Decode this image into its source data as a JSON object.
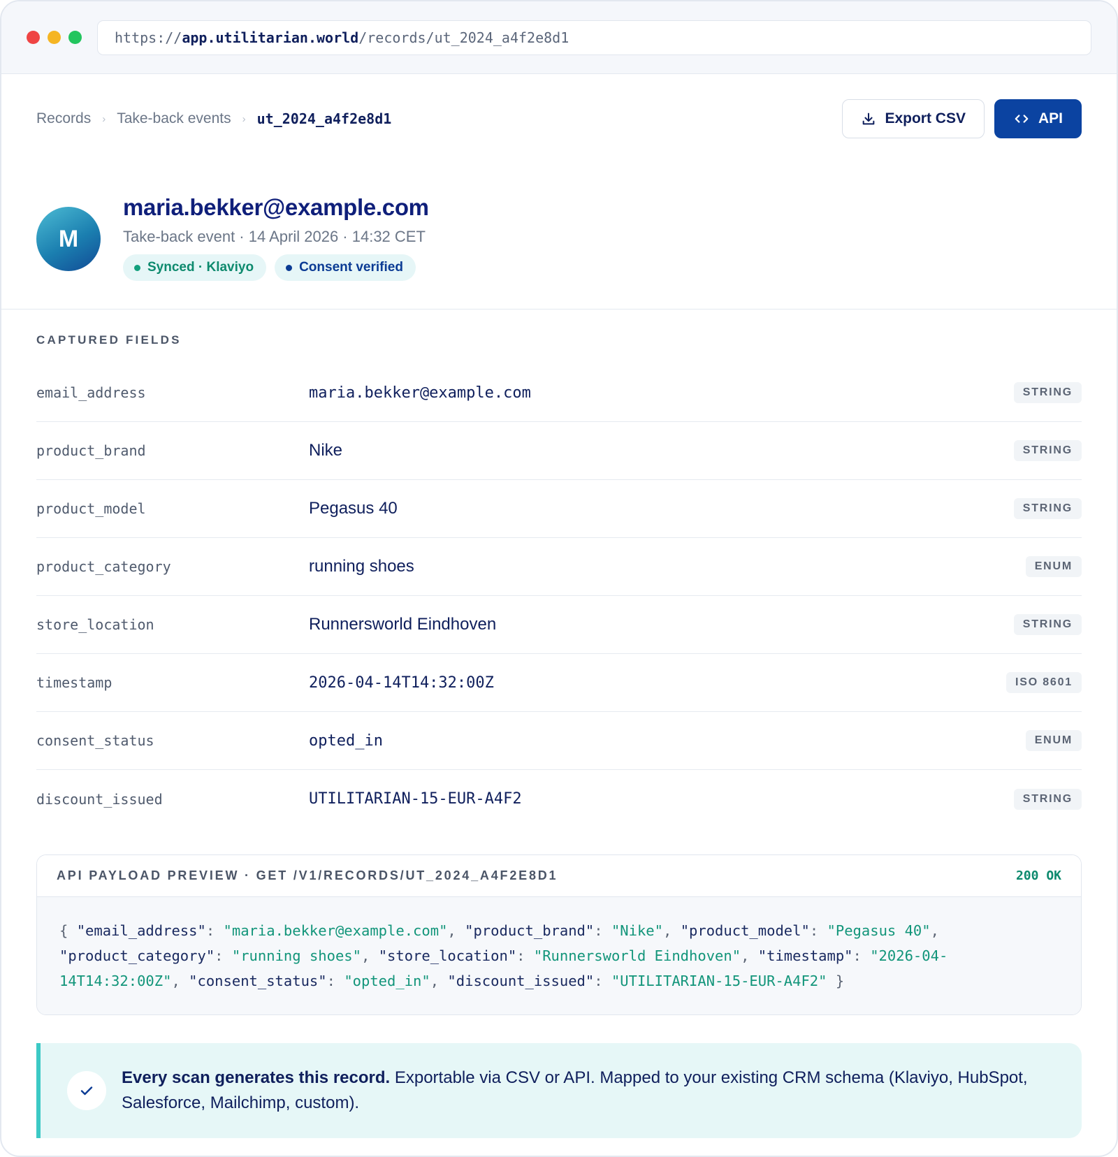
{
  "browser": {
    "url_scheme": "https://",
    "url_host": "app.utilitarian.world",
    "url_path": "/records/ut_2024_a4f2e8d1"
  },
  "breadcrumb": {
    "items": [
      "Records",
      "Take-back events"
    ],
    "current": "ut_2024_a4f2e8d1"
  },
  "actions": {
    "export_label": "Export CSV",
    "api_label": "API"
  },
  "profile": {
    "avatar_initial": "M",
    "email": "maria.bekker@example.com",
    "subtitle": "Take-back event · 14 April 2026 · 14:32 CET",
    "badges": [
      "Synced · Klaviyo",
      "Consent verified"
    ]
  },
  "fields": {
    "section_label": "CAPTURED FIELDS",
    "rows": [
      {
        "key": "email_address",
        "value": "maria.bekker@example.com",
        "type": "STRING"
      },
      {
        "key": "product_brand",
        "value": "Nike",
        "type": "STRING"
      },
      {
        "key": "product_model",
        "value": "Pegasus 40",
        "type": "STRING"
      },
      {
        "key": "product_category",
        "value": "running shoes",
        "type": "ENUM"
      },
      {
        "key": "store_location",
        "value": "Runnersworld Eindhoven",
        "type": "STRING"
      },
      {
        "key": "timestamp",
        "value": "2026-04-14T14:32:00Z",
        "type": "ISO 8601"
      },
      {
        "key": "consent_status",
        "value": "opted_in",
        "type": "ENUM"
      },
      {
        "key": "discount_issued",
        "value": "UTILITARIAN-15-EUR-A4F2",
        "type": "STRING"
      }
    ]
  },
  "payload": {
    "title": "API PAYLOAD PREVIEW · GET /V1/RECORDS/UT_2024_A4F2E8D1",
    "status": "200 OK",
    "line1": [
      {
        "t": "{ ",
        "c": "p"
      },
      {
        "t": "\"email_address\"",
        "c": "k"
      },
      {
        "t": ": ",
        "c": "p"
      },
      {
        "t": "\"maria.bekker@example.com\"",
        "c": "v"
      },
      {
        "t": ", ",
        "c": "p"
      },
      {
        "t": "\"product_brand\"",
        "c": "k"
      },
      {
        "t": ": ",
        "c": "p"
      },
      {
        "t": "\"Nike\"",
        "c": "v"
      },
      {
        "t": ", ",
        "c": "p"
      },
      {
        "t": "\"product_model\"",
        "c": "k"
      },
      {
        "t": ": ",
        "c": "p"
      },
      {
        "t": "\"Pegasus 40\"",
        "c": "v"
      },
      {
        "t": ",",
        "c": "p"
      }
    ],
    "line2": [
      {
        "t": "\"product_category\"",
        "c": "k"
      },
      {
        "t": ": ",
        "c": "p"
      },
      {
        "t": "\"running shoes\"",
        "c": "v"
      },
      {
        "t": ", ",
        "c": "p"
      },
      {
        "t": "\"store_location\"",
        "c": "k"
      },
      {
        "t": ": ",
        "c": "p"
      },
      {
        "t": "\"Runnersworld Eindhoven\"",
        "c": "v"
      },
      {
        "t": ", ",
        "c": "p"
      },
      {
        "t": "\"timestamp\"",
        "c": "k"
      },
      {
        "t": ": ",
        "c": "p"
      },
      {
        "t": "\"2026-04-",
        "c": "v"
      }
    ],
    "line3": [
      {
        "t": "14T14:32:00Z\"",
        "c": "v"
      },
      {
        "t": ", ",
        "c": "p"
      },
      {
        "t": "\"consent_status\"",
        "c": "k"
      },
      {
        "t": ": ",
        "c": "p"
      },
      {
        "t": "\"opted_in\"",
        "c": "v"
      },
      {
        "t": ", ",
        "c": "p"
      },
      {
        "t": "\"discount_issued\"",
        "c": "k"
      },
      {
        "t": ": ",
        "c": "p"
      },
      {
        "t": "\"UTILITARIAN-15-EUR-A4F2\"",
        "c": "v"
      },
      {
        "t": " }",
        "c": "p"
      }
    ]
  },
  "callout": {
    "bold": "Every scan generates this record.",
    "text": " Exportable via CSV or API. Mapped to your existing CRM schema (Klaviyo, HubSpot, Salesforce, Mailchimp, custom)."
  },
  "colors": {
    "primary": "#0b43a1",
    "success": "#12957a",
    "accent": "#3cc9c5"
  },
  "icons": [
    "download-icon",
    "code-icon",
    "check-icon"
  ]
}
